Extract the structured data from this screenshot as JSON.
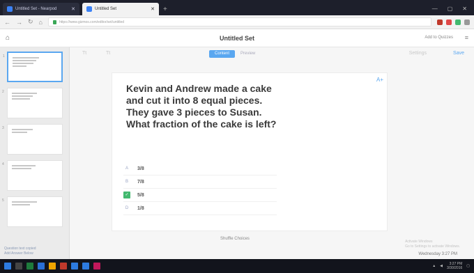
{
  "browser": {
    "tabs": [
      {
        "label": "Untitled Set - Nearpod",
        "active": false
      },
      {
        "label": "Untitled Set",
        "active": true
      }
    ],
    "url": "https://www.gizmos.com/editor/set/untitled",
    "new_tab": "+",
    "window_controls": [
      "—",
      "▢",
      "✕"
    ]
  },
  "app": {
    "title": "Untitled Set",
    "add_button": "Add to Quizzes",
    "more": "≡"
  },
  "toolbar": {
    "left_tools": [
      "Tt",
      "Tt"
    ],
    "segments": [
      {
        "label": "Content",
        "on": true
      },
      {
        "label": "Preview",
        "on": false
      }
    ],
    "settings": "Settings",
    "save": "Save"
  },
  "sidebar": {
    "slides": [
      "1",
      "2",
      "3",
      "4",
      "5"
    ],
    "footer": [
      "Question text copied",
      "Add Answer Below"
    ]
  },
  "card": {
    "question": "Kevin and Andrew made a cake and cut it into 8 equal pieces. They gave 3 pieces to Susan. What fraction of the cake is left?",
    "choices": [
      {
        "letter": "A",
        "value": "3/8",
        "correct": false
      },
      {
        "letter": "B",
        "value": "7/8",
        "correct": false
      },
      {
        "letter": "C",
        "value": "5/8",
        "correct": true
      },
      {
        "letter": "D",
        "value": "1/8",
        "correct": false
      }
    ],
    "shuffle": "Shuffle Choices",
    "side_icon": "A+"
  },
  "status": {
    "watermark_lines": [
      "Activate Windows",
      "Go to Settings to activate Windows."
    ],
    "corner": "Wednesday 3:27 PM"
  },
  "taskbar": {
    "icon_colors": [
      "#2d7be0",
      "#444",
      "#1e7b3c",
      "#2a6fd6",
      "#f0a500",
      "#c0392b",
      "#2d7be0",
      "#2d7be0",
      "#c2185b"
    ],
    "time": "3:27 PM",
    "date": "3/30/2016"
  },
  "colors": {
    "accent": "#5aa7f0",
    "correct": "#43b96f"
  }
}
